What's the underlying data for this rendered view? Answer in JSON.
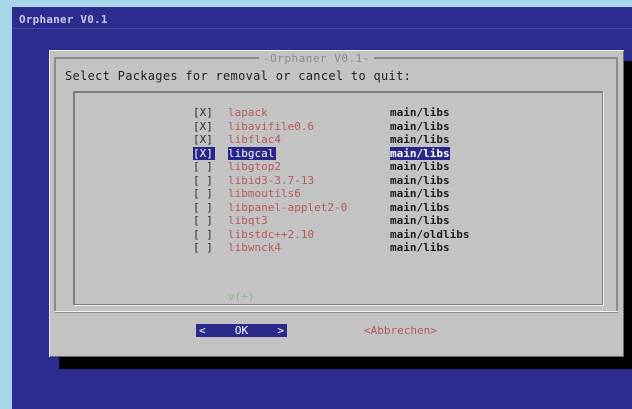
{
  "app": {
    "title": "Orphaner V0.1"
  },
  "dialog": {
    "title": "-Orphaner V0.1-",
    "prompt": "Select Packages for removal or cancel to quit:",
    "more_marker": "v(+)"
  },
  "packages": [
    {
      "check": "[X]",
      "name": "lapack",
      "section": "main/libs",
      "selected": false
    },
    {
      "check": "[X]",
      "name": "libavifile0.6",
      "section": "main/libs",
      "selected": false
    },
    {
      "check": "[X]",
      "name": "libflac4",
      "section": "main/libs",
      "selected": false
    },
    {
      "check": "[X]",
      "name": "libgcal",
      "section": "main/libs",
      "selected": true
    },
    {
      "check": "[ ]",
      "name": "libgtop2",
      "section": "main/libs",
      "selected": false
    },
    {
      "check": "[ ]",
      "name": "libid3-3.7-13",
      "section": "main/libs",
      "selected": false
    },
    {
      "check": "[ ]",
      "name": "libmoutils6",
      "section": "main/libs",
      "selected": false
    },
    {
      "check": "[ ]",
      "name": "libpanel-applet2-0",
      "section": "main/libs",
      "selected": false
    },
    {
      "check": "[ ]",
      "name": "libqt3",
      "section": "main/libs",
      "selected": false
    },
    {
      "check": "[ ]",
      "name": "libstdc++2.10",
      "section": "main/oldlibs",
      "selected": false
    },
    {
      "check": "[ ]",
      "name": "libwnck4",
      "section": "main/libs",
      "selected": false
    }
  ],
  "buttons": {
    "ok": {
      "left": "<",
      "label": "OK",
      "right": ">"
    },
    "cancel": "<Abbrechen>"
  },
  "colors": {
    "background": "#2c2b8e",
    "dialog": "#c3c3c3",
    "highlight": "#27278a",
    "accent_text": "#b45a5a"
  }
}
